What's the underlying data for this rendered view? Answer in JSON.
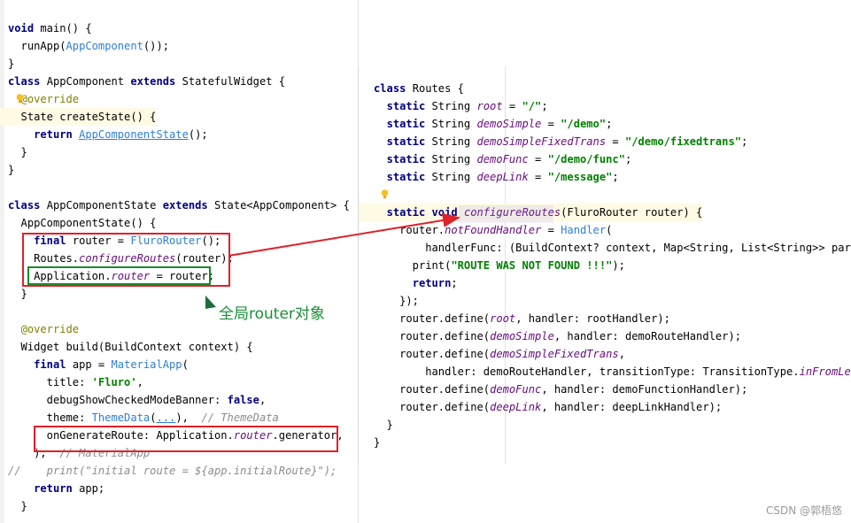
{
  "left_code": [
    {
      "tokens": [
        {
          "t": "void ",
          "c": "kw"
        },
        {
          "t": "main() {"
        }
      ]
    },
    {
      "tokens": [
        {
          "t": "  runApp("
        },
        {
          "t": "AppComponent",
          "c": "call"
        },
        {
          "t": "());"
        }
      ]
    },
    {
      "tokens": [
        {
          "t": "}"
        }
      ]
    },
    {
      "tokens": [
        {
          "t": "class ",
          "c": "kw"
        },
        {
          "t": "AppComponent "
        },
        {
          "t": "extends ",
          "c": "kw"
        },
        {
          "t": "StatefulWidget {"
        }
      ]
    },
    {
      "tokens": [
        {
          "t": "  "
        },
        {
          "t": "@override",
          "c": "ann"
        }
      ]
    },
    {
      "tokens": [
        {
          "t": "  State createState() {"
        }
      ]
    },
    {
      "tokens": [
        {
          "t": "    "
        },
        {
          "t": "return ",
          "c": "kw"
        },
        {
          "t": "AppComponentState",
          "c": "link"
        },
        {
          "t": "();"
        }
      ]
    },
    {
      "tokens": [
        {
          "t": "  }"
        }
      ]
    },
    {
      "tokens": [
        {
          "t": "}"
        }
      ]
    },
    {
      "tokens": [
        {
          "t": ""
        }
      ]
    },
    {
      "tokens": [
        {
          "t": "class ",
          "c": "kw"
        },
        {
          "t": "AppComponentState "
        },
        {
          "t": "extends ",
          "c": "kw"
        },
        {
          "t": "State<AppComponent> {"
        }
      ]
    },
    {
      "tokens": [
        {
          "t": "  AppComponentState() {"
        }
      ]
    },
    {
      "tokens": [
        {
          "t": "    "
        },
        {
          "t": "final ",
          "c": "kw"
        },
        {
          "t": "router = "
        },
        {
          "t": "FluroRouter",
          "c": "call"
        },
        {
          "t": "();"
        }
      ]
    },
    {
      "tokens": [
        {
          "t": "    Routes."
        },
        {
          "t": "configureRoutes",
          "c": "ital"
        },
        {
          "t": "(router);"
        }
      ]
    },
    {
      "tokens": [
        {
          "t": "    Application."
        },
        {
          "t": "router",
          "c": "fieldit"
        },
        {
          "t": " = router;"
        }
      ]
    },
    {
      "tokens": [
        {
          "t": "  }"
        }
      ]
    },
    {
      "tokens": [
        {
          "t": ""
        }
      ]
    },
    {
      "tokens": [
        {
          "t": "  "
        },
        {
          "t": "@override",
          "c": "ann"
        }
      ]
    },
    {
      "tokens": [
        {
          "t": "  Widget build(BuildContext context) {"
        }
      ]
    },
    {
      "tokens": [
        {
          "t": "    "
        },
        {
          "t": "final ",
          "c": "kw"
        },
        {
          "t": "app = "
        },
        {
          "t": "MaterialApp",
          "c": "call"
        },
        {
          "t": "("
        }
      ]
    },
    {
      "tokens": [
        {
          "t": "      title: "
        },
        {
          "t": "'Fluro'",
          "c": "str"
        },
        {
          "t": ","
        }
      ]
    },
    {
      "tokens": [
        {
          "t": "      debugShowCheckedModeBanner: "
        },
        {
          "t": "false",
          "c": "kw"
        },
        {
          "t": ","
        }
      ]
    },
    {
      "tokens": [
        {
          "t": "      theme: "
        },
        {
          "t": "ThemeData",
          "c": "call"
        },
        {
          "t": "("
        },
        {
          "t": "...",
          "c": "link"
        },
        {
          "t": "),  "
        },
        {
          "t": "// ThemeData",
          "c": "cmt"
        }
      ]
    },
    {
      "tokens": [
        {
          "t": "      onGenerateRoute: Application."
        },
        {
          "t": "router",
          "c": "fieldit"
        },
        {
          "t": ".generator,"
        }
      ]
    },
    {
      "tokens": [
        {
          "t": "    );  "
        },
        {
          "t": "// MaterialApp",
          "c": "cmt"
        }
      ]
    },
    {
      "tokens": [
        {
          "t": "//    print(\"initial route = ${app.initialRoute}\");",
          "c": "cmt"
        }
      ]
    },
    {
      "tokens": [
        {
          "t": "    "
        },
        {
          "t": "return ",
          "c": "kw"
        },
        {
          "t": "app;"
        }
      ]
    },
    {
      "tokens": [
        {
          "t": "  }"
        }
      ]
    }
  ],
  "right_code": [
    {
      "tokens": [
        {
          "t": "class ",
          "c": "kw"
        },
        {
          "t": "Routes {"
        }
      ]
    },
    {
      "tokens": [
        {
          "t": "  "
        },
        {
          "t": "static ",
          "c": "kw"
        },
        {
          "t": "String "
        },
        {
          "t": "root",
          "c": "ital"
        },
        {
          "t": " = "
        },
        {
          "t": "\"/\"",
          "c": "str"
        },
        {
          "t": ";"
        }
      ]
    },
    {
      "tokens": [
        {
          "t": "  "
        },
        {
          "t": "static ",
          "c": "kw"
        },
        {
          "t": "String "
        },
        {
          "t": "demoSimple",
          "c": "ital"
        },
        {
          "t": " = "
        },
        {
          "t": "\"/demo\"",
          "c": "str"
        },
        {
          "t": ";"
        }
      ]
    },
    {
      "tokens": [
        {
          "t": "  "
        },
        {
          "t": "static ",
          "c": "kw"
        },
        {
          "t": "String "
        },
        {
          "t": "demoSimpleFixedTrans",
          "c": "ital"
        },
        {
          "t": " = "
        },
        {
          "t": "\"/demo/fixedtrans\"",
          "c": "str"
        },
        {
          "t": ";"
        }
      ]
    },
    {
      "tokens": [
        {
          "t": "  "
        },
        {
          "t": "static ",
          "c": "kw"
        },
        {
          "t": "String "
        },
        {
          "t": "demoFunc",
          "c": "ital"
        },
        {
          "t": " = "
        },
        {
          "t": "\"/demo/func\"",
          "c": "str"
        },
        {
          "t": ";"
        }
      ]
    },
    {
      "tokens": [
        {
          "t": "  "
        },
        {
          "t": "static ",
          "c": "kw"
        },
        {
          "t": "String "
        },
        {
          "t": "deepLink",
          "c": "ital"
        },
        {
          "t": " = "
        },
        {
          "t": "\"/message\"",
          "c": "str"
        },
        {
          "t": ";"
        }
      ]
    },
    {
      "tokens": [
        {
          "t": ""
        }
      ]
    },
    {
      "tokens": [
        {
          "t": "  "
        },
        {
          "t": "static ",
          "c": "kw"
        },
        {
          "t": "void ",
          "c": "kw"
        },
        {
          "t": "configureRoutes",
          "c": "ital"
        },
        {
          "t": "(FluroRouter router) {"
        }
      ]
    },
    {
      "tokens": [
        {
          "t": "    router."
        },
        {
          "t": "notFoundHandler",
          "c": "fieldit"
        },
        {
          "t": " = "
        },
        {
          "t": "Handler",
          "c": "call"
        },
        {
          "t": "("
        }
      ]
    },
    {
      "tokens": [
        {
          "t": "        handlerFunc: (BuildContext? context, Map<String, List<String>> params) {"
        }
      ]
    },
    {
      "tokens": [
        {
          "t": "      print("
        },
        {
          "t": "\"ROUTE WAS NOT FOUND !!!\"",
          "c": "str"
        },
        {
          "t": ");"
        }
      ]
    },
    {
      "tokens": [
        {
          "t": "      "
        },
        {
          "t": "return",
          "c": "kw"
        },
        {
          "t": ";"
        }
      ]
    },
    {
      "tokens": [
        {
          "t": "    });"
        }
      ]
    },
    {
      "tokens": [
        {
          "t": "    router.define("
        },
        {
          "t": "root",
          "c": "ital"
        },
        {
          "t": ", handler: rootHandler);"
        }
      ]
    },
    {
      "tokens": [
        {
          "t": "    router.define("
        },
        {
          "t": "demoSimple",
          "c": "ital"
        },
        {
          "t": ", handler: demoRouteHandler);"
        }
      ]
    },
    {
      "tokens": [
        {
          "t": "    router.define("
        },
        {
          "t": "demoSimpleFixedTrans",
          "c": "ital"
        },
        {
          "t": ","
        }
      ]
    },
    {
      "tokens": [
        {
          "t": "        handler: demoRouteHandler, transitionType: TransitionType."
        },
        {
          "t": "inFromLeft",
          "c": "fieldit"
        },
        {
          "t": ");"
        }
      ]
    },
    {
      "tokens": [
        {
          "t": "    router.define("
        },
        {
          "t": "demoFunc",
          "c": "ital"
        },
        {
          "t": ", handler: demoFunctionHandler);"
        }
      ]
    },
    {
      "tokens": [
        {
          "t": "    router.define("
        },
        {
          "t": "deepLink",
          "c": "ital"
        },
        {
          "t": ", handler: deepLinkHandler);"
        }
      ]
    },
    {
      "tokens": [
        {
          "t": "  }"
        }
      ]
    },
    {
      "tokens": [
        {
          "t": "}"
        }
      ]
    }
  ],
  "annotation": {
    "text": "全局router对象"
  },
  "watermark": {
    "text": "CSDN @郭梧悠"
  },
  "colors": {
    "red_box": "#e0202a",
    "green_box": "#1a8a2e",
    "arrow": "#e0202a",
    "note": "#1b8f3a"
  },
  "icons": {
    "bulb": "lightbulb-icon",
    "arrow": "arrow-icon"
  }
}
